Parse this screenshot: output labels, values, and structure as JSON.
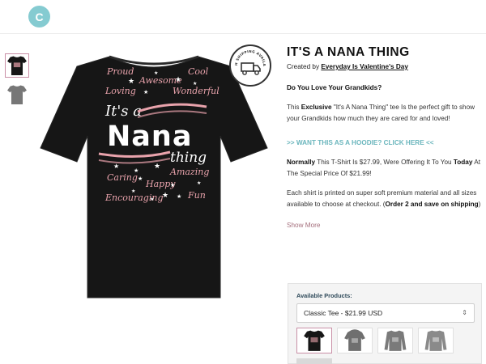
{
  "header": {
    "logo_letter": "C"
  },
  "badge": {
    "text": "RUSH SHIPPING AVAILABLE"
  },
  "shirt": {
    "words": {
      "proud": "Proud",
      "cool": "Cool",
      "awesome": "Awesome",
      "loving": "Loving",
      "wonderful": "Wonderful",
      "its_a": "It's a",
      "nana": "Nana",
      "thing": "thing",
      "caring": "Caring",
      "amazing": "Amazing",
      "happy": "Happy",
      "encouraging": "Encouraging",
      "fun": "Fun"
    }
  },
  "product": {
    "title": "IT'S A NANA THING",
    "created_prefix": "Created by",
    "creator": "Everyday Is Valentine's Day",
    "question": "Do You Love Your Grandkids?",
    "para1_prefix": "This",
    "para1_bold": "Exclusive",
    "para1_rest": "\"It's A Nana Thing\" tee Is the perfect gift to show your Grandkids how much they are cared for and loved!",
    "hoodie_link": ">> WANT THIS AS A HOODIE? CLICK HERE <<",
    "para2_bold1": "Normally",
    "para2_mid": "This T-Shirt Is $27.99, Were Offering It To You",
    "para2_bold2": "Today",
    "para2_end": "At The Special Price Of $21.99!",
    "para3_text": "Each shirt is printed on super soft premium material and all sizes available to choose at checkout. (",
    "para3_bold": "Order 2 and save on shipping",
    "para3_close": ")",
    "show_more": "Show More"
  },
  "products_panel": {
    "label": "Available Products:",
    "selected": "Classic Tee - $21.99 USD"
  },
  "colors": {
    "accent_teal": "#6bb6bd",
    "logo_teal": "#85cbd1",
    "show_more_mauve": "#a46e7c",
    "shirt_black": "#161616",
    "pink_print": "#e9a3ac"
  }
}
